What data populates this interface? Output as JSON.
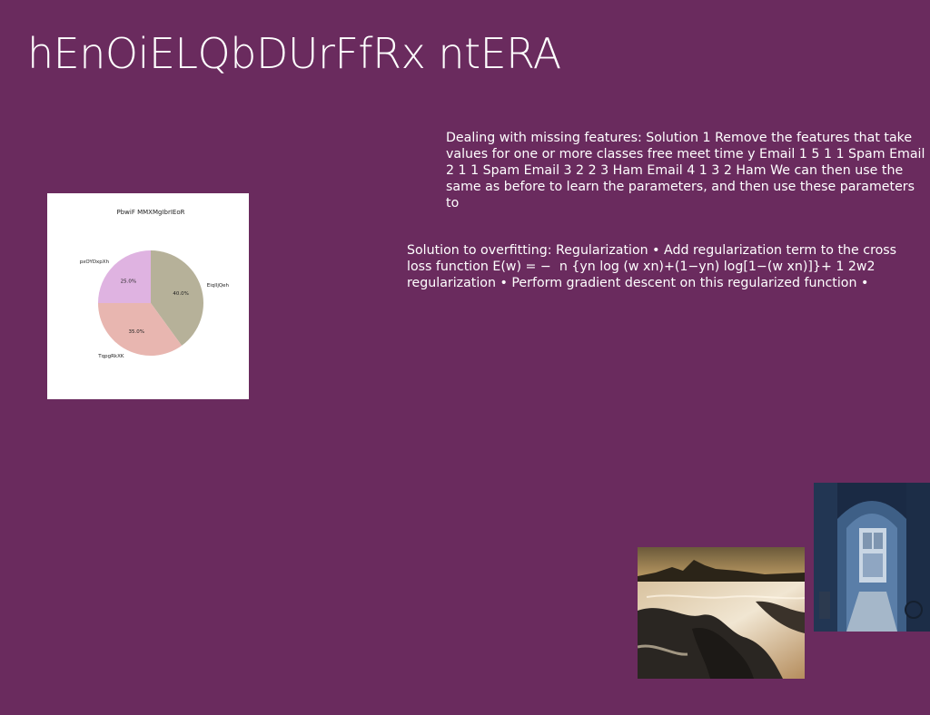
{
  "slide": {
    "title": "hEnOiELQbDUrFfRx ntERA",
    "paragraph_1": "Dealing with missing features: Solution 1 Remove the features that take values for one or more classes free meet time y Email 1 5 1 1 Spam Email 2 1 1 Spam Email 3 2 2 3 Ham Email 4 1 3 2 Ham We can then use the same as before to learn the parameters, and then use these parameters to",
    "paragraph_2": "Solution to overfitting: Regularization • Add regularization term to the cross loss function E(w) = − ￼ n {yn log ￼(w ￼xn)+(1−yn) log[1−￼(w ￼xn)]}+ 1 2￼￼w￼2 ￼ ￼￼ ￼ regularization • Perform gradient descent on this regularized function •"
  },
  "chart_data": {
    "type": "pie",
    "title": "PbwiF MMXMgIbrIEoR",
    "slices": [
      {
        "label": "EiqlljQeh",
        "value": 40.0,
        "pct_label": "40.0%",
        "color": "#b6b199"
      },
      {
        "label": "TqpgRkXK",
        "value": 35.0,
        "pct_label": "35.0%",
        "color": "#e8b6b0"
      },
      {
        "label": "pxOYDxpXh",
        "value": 25.0,
        "pct_label": "25.0%",
        "color": "#dfb3e1"
      }
    ],
    "start_angle": "top, clockwise"
  },
  "images": {
    "sea": {
      "icon": "stormy-sea-rocks-photo"
    },
    "alley": {
      "icon": "blue-archway-alley-photo"
    }
  }
}
